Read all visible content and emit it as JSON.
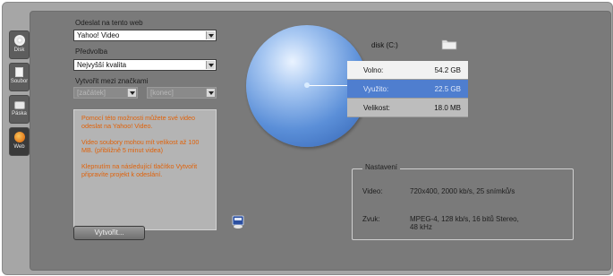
{
  "tabs": [
    {
      "label": "Disk",
      "icon": "disc-icon"
    },
    {
      "label": "Soubor",
      "icon": "file-icon"
    },
    {
      "label": "Páska",
      "icon": "tape-icon"
    },
    {
      "label": "Web",
      "icon": "globe-icon",
      "active": true
    }
  ],
  "form": {
    "send_label": "Odeslat na tento web",
    "send_value": "Yahoo! Video",
    "preset_label": "Předvolba",
    "preset_value": "Nejvyšší kvalita",
    "markers_label": "Vytvořit mezi značkami",
    "start_value": "[začátek]",
    "end_value": "[konec]"
  },
  "info": {
    "p1": "Pomocí této možnosti můžete své video odeslat na Yahoo! Video.",
    "p2": "Video soubory mohou mít velikost až 100 MB. (přibližně 5 minut videa)",
    "p3": "Klepnutím na následující tlačítko Vytvořit připravíte projekt k odeslání."
  },
  "create_button": "Vytvořit...",
  "disk": {
    "title": "disk (C:)",
    "rows": [
      {
        "label": "Volno:",
        "value": "54.2 GB"
      },
      {
        "label": "Využito:",
        "value": "22.5 GB"
      },
      {
        "label": "Velikost:",
        "value": "18.0 MB"
      }
    ]
  },
  "settings": {
    "legend": "Nastavení",
    "video_label": "Video:",
    "video_value": "720x400, 2000 kb/s, 25 snímků/s",
    "audio_label": "Zvuk:",
    "audio_value_line1": "MPEG-4, 128 kb/s, 16 bitů Stereo,",
    "audio_value_line2": "48 kHz"
  },
  "colors": {
    "info_text": "#e0620a",
    "used_row": "#4f7ecf",
    "pie": "#5b8fd8"
  }
}
